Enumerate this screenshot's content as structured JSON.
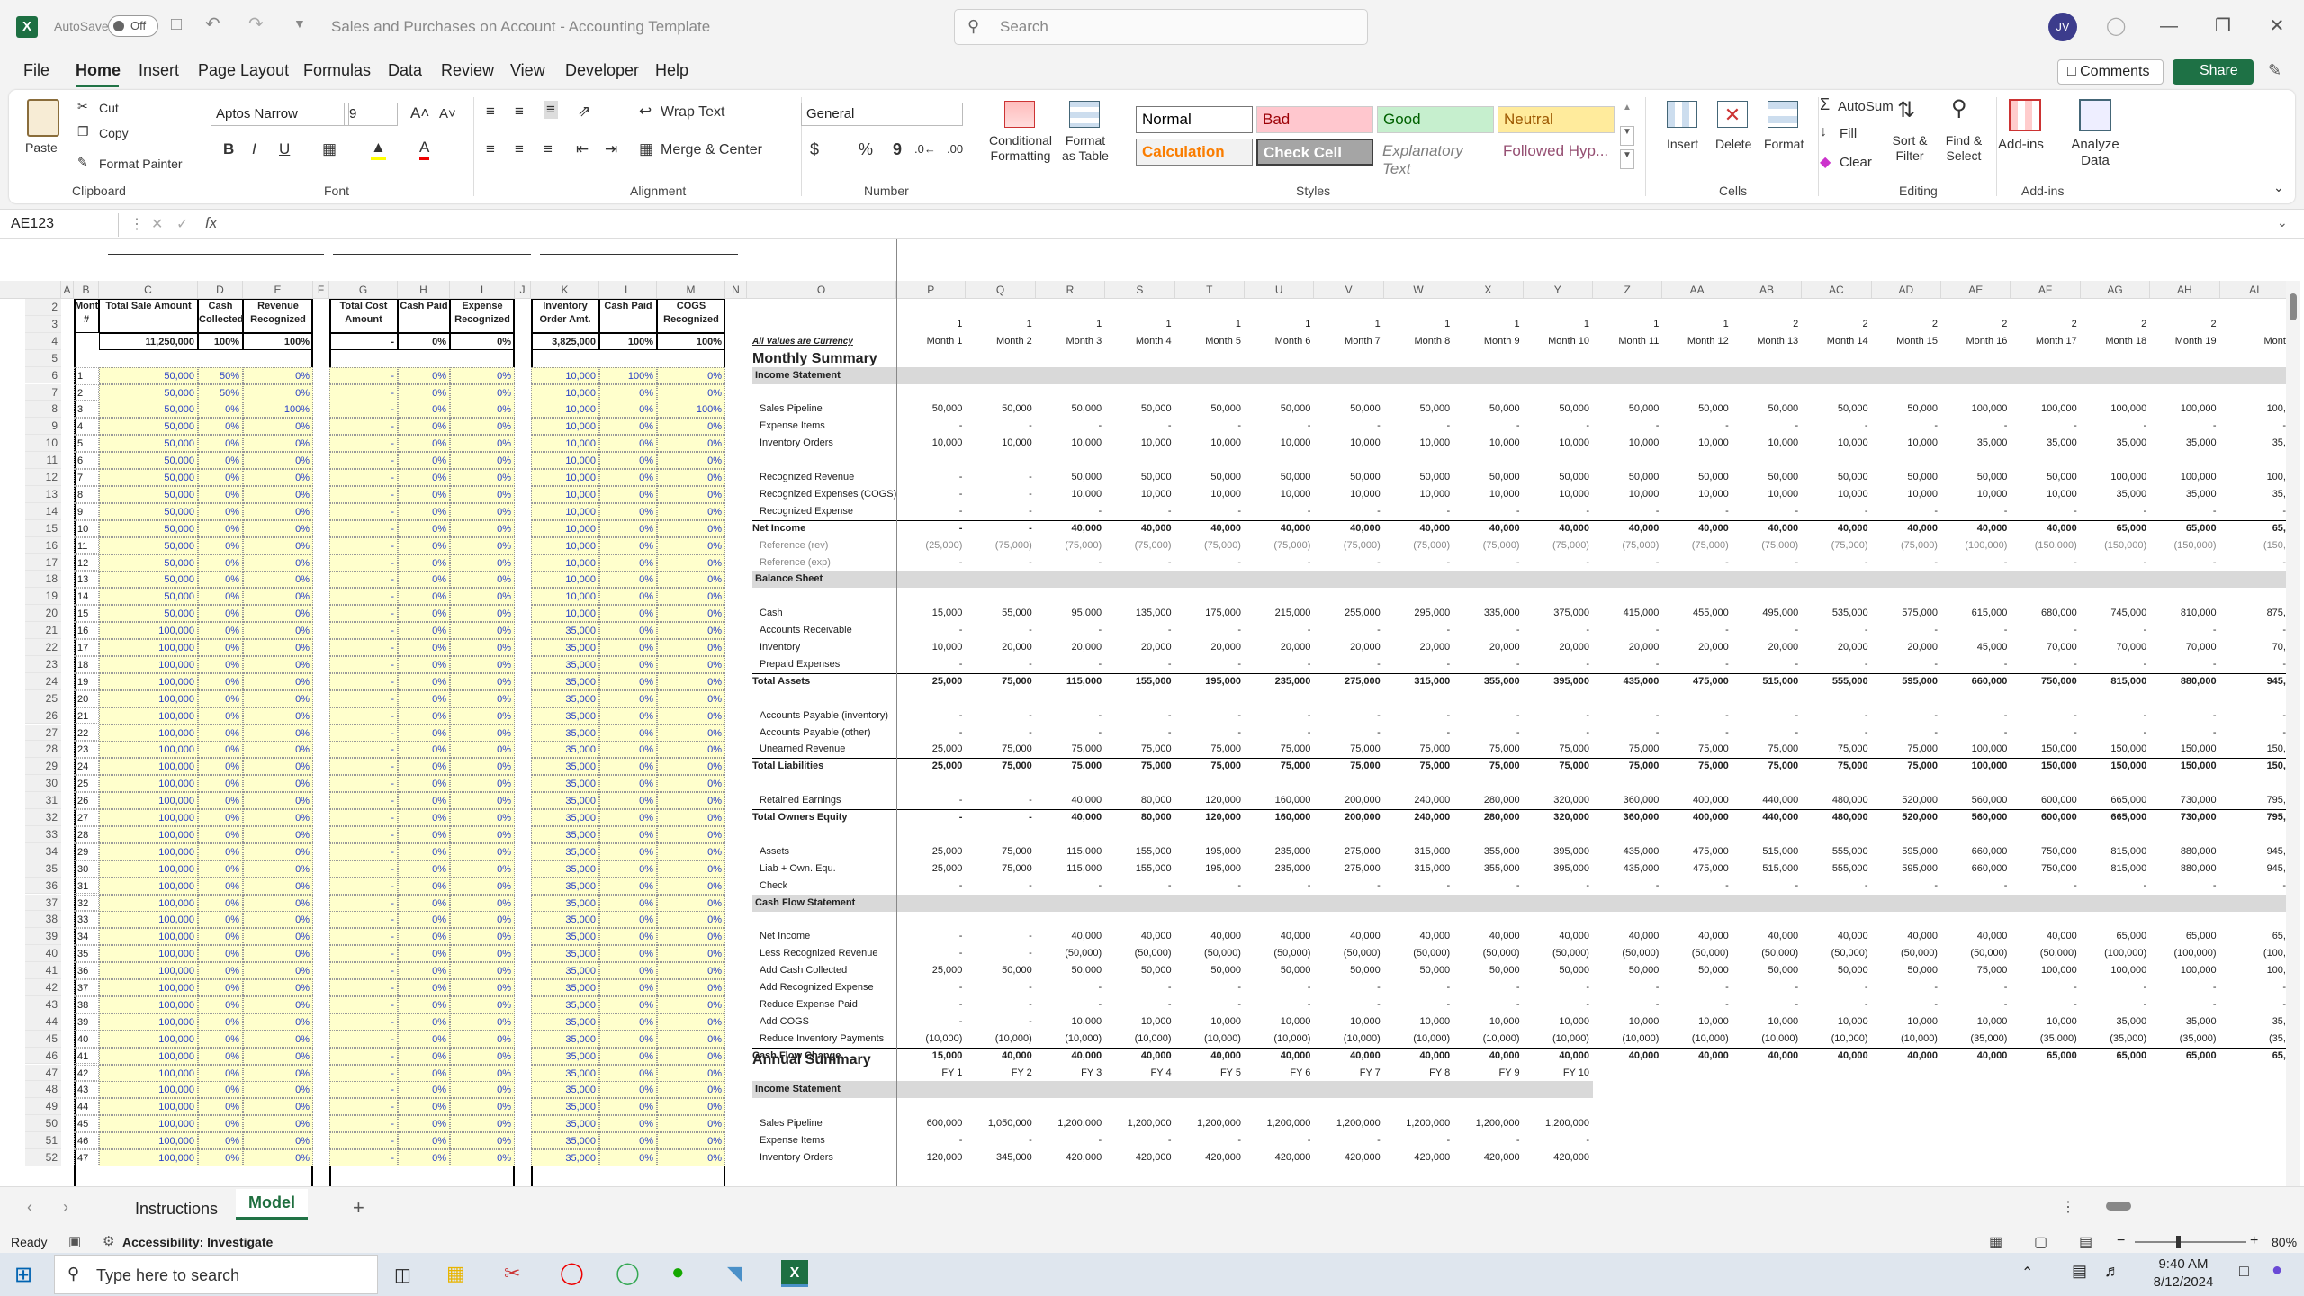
{
  "app": {
    "autosave": "AutoSave",
    "autosave_state": "Off",
    "title": "Sales and Purchases on Account - Accounting Template",
    "search_placeholder": "Search",
    "user_initials": "JV"
  },
  "menu": [
    "File",
    "Home",
    "Insert",
    "Page Layout",
    "Formulas",
    "Data",
    "Review",
    "View",
    "Developer",
    "Help"
  ],
  "menu_right": {
    "comments": "Comments",
    "share": "Share"
  },
  "ribbon": {
    "clipboard": {
      "paste": "Paste",
      "cut": "Cut",
      "copy": "Copy",
      "format_painter": "Format Painter",
      "label": "Clipboard"
    },
    "font": {
      "name": "Aptos Narrow",
      "size": "9",
      "label": "Font"
    },
    "alignment": {
      "wrap": "Wrap Text",
      "merge": "Merge & Center",
      "label": "Alignment"
    },
    "number": {
      "format": "General",
      "label": "Number"
    },
    "styles": {
      "cond": "Conditional Formatting",
      "table": "Format as Table",
      "normal": "Normal",
      "bad": "Bad",
      "good": "Good",
      "neutral": "Neutral",
      "calc": "Calculation",
      "check": "Check Cell",
      "explan": "Explanatory Text",
      "followed": "Followed Hyp...",
      "label": "Styles"
    },
    "cells": {
      "insert": "Insert",
      "delete": "Delete",
      "format": "Format",
      "label": "Cells"
    },
    "editing": {
      "autosum": "AutoSum",
      "fill": "Fill",
      "clear": "Clear",
      "sort": "Sort & Filter",
      "find": "Find & Select",
      "label": "Editing"
    },
    "addins": {
      "addins": "Add-ins",
      "analyze": "Analyze Data",
      "label": "Add-ins"
    }
  },
  "namebox": "AE123",
  "fx": "fx",
  "col_headers": [
    "A",
    "B",
    "C",
    "D",
    "E",
    "F",
    "G",
    "H",
    "I",
    "J",
    "K",
    "L",
    "M",
    "N",
    "O",
    "P",
    "Q",
    "R",
    "S",
    "T",
    "U",
    "V",
    "W",
    "X",
    "Y",
    "Z",
    "AA",
    "AB",
    "AC",
    "AD",
    "AE",
    "AF",
    "AG",
    "AH",
    "AI"
  ],
  "left_headers": {
    "month": "Month #",
    "total_sale": "Total Sale Amount",
    "cash_collected": "Cash Collected",
    "rev_recog": "Revenue Recognized",
    "total_cost": "Total Cost Amount",
    "cash_paid": "Cash Paid",
    "exp_recog": "Expense Recognized",
    "inv_order": "Inventory Order Amt.",
    "cash_paid2": "Cash Paid",
    "cogs_recog": "COGS Recognized"
  },
  "left_totals": {
    "sale": "11,250,000",
    "cc": "100%",
    "rr": "100%",
    "cost": "-",
    "cp": "0%",
    "er": "0%",
    "inv": "3,825,000",
    "cp2": "100%",
    "cogs": "100%"
  },
  "currency_note": "All Values are Currency",
  "month_labels": [
    "Month 1",
    "Month 2",
    "Month 3",
    "Month 4",
    "Month 5",
    "Month 6",
    "Month 7",
    "Month 8",
    "Month 9",
    "Month 10",
    "Month 11",
    "Month 12",
    "Month 13",
    "Month 14",
    "Month 15",
    "Month 16",
    "Month 17",
    "Month 18",
    "Month 19",
    "Mont"
  ],
  "year_labels": [
    "1",
    "1",
    "1",
    "1",
    "1",
    "1",
    "1",
    "1",
    "1",
    "1",
    "1",
    "1",
    "2",
    "2",
    "2",
    "2",
    "2",
    "2",
    "2",
    ""
  ],
  "summary": {
    "monthly": "Monthly Summary",
    "income": "Income Statement",
    "balance": "Balance Sheet",
    "cashflow": "Cash Flow Statement",
    "annual": "Annual Summary",
    "fy": [
      "FY 1",
      "FY 2",
      "FY 3",
      "FY 4",
      "FY 5",
      "FY 6",
      "FY 7",
      "FY 8",
      "FY 9",
      "FY 10"
    ]
  },
  "rows": [
    {
      "r": 6,
      "label": "Sales Pipeline",
      "v": [
        "50,000",
        "50,000",
        "50,000",
        "50,000",
        "50,000",
        "50,000",
        "50,000",
        "50,000",
        "50,000",
        "50,000",
        "50,000",
        "50,000",
        "50,000",
        "50,000",
        "50,000",
        "100,000",
        "100,000",
        "100,000",
        "100,000",
        "100,"
      ]
    },
    {
      "r": 7,
      "label": "Expense Items",
      "v": [
        "-",
        "-",
        "-",
        "-",
        "-",
        "-",
        "-",
        "-",
        "-",
        "-",
        "-",
        "-",
        "-",
        "-",
        "-",
        "-",
        "-",
        "-",
        "-",
        "-"
      ]
    },
    {
      "r": 8,
      "label": "Inventory Orders",
      "v": [
        "10,000",
        "10,000",
        "10,000",
        "10,000",
        "10,000",
        "10,000",
        "10,000",
        "10,000",
        "10,000",
        "10,000",
        "10,000",
        "10,000",
        "10,000",
        "10,000",
        "10,000",
        "35,000",
        "35,000",
        "35,000",
        "35,000",
        "35,"
      ]
    },
    {
      "r": 10,
      "label": "Recognized Revenue",
      "v": [
        "-",
        "-",
        "50,000",
        "50,000",
        "50,000",
        "50,000",
        "50,000",
        "50,000",
        "50,000",
        "50,000",
        "50,000",
        "50,000",
        "50,000",
        "50,000",
        "50,000",
        "50,000",
        "50,000",
        "100,000",
        "100,000",
        "100,"
      ]
    },
    {
      "r": 11,
      "label": "Recognized Expenses (COGS)",
      "v": [
        "-",
        "-",
        "10,000",
        "10,000",
        "10,000",
        "10,000",
        "10,000",
        "10,000",
        "10,000",
        "10,000",
        "10,000",
        "10,000",
        "10,000",
        "10,000",
        "10,000",
        "10,000",
        "10,000",
        "35,000",
        "35,000",
        "35,"
      ]
    },
    {
      "r": 12,
      "label": "Recognized Expense",
      "v": [
        "-",
        "-",
        "-",
        "-",
        "-",
        "-",
        "-",
        "-",
        "-",
        "-",
        "-",
        "-",
        "-",
        "-",
        "-",
        "-",
        "-",
        "-",
        "-",
        "-"
      ]
    },
    {
      "r": 13,
      "label": "Net Income",
      "bold": true,
      "v": [
        "-",
        "-",
        "40,000",
        "40,000",
        "40,000",
        "40,000",
        "40,000",
        "40,000",
        "40,000",
        "40,000",
        "40,000",
        "40,000",
        "40,000",
        "40,000",
        "40,000",
        "40,000",
        "40,000",
        "65,000",
        "65,000",
        "65,"
      ]
    },
    {
      "r": 14,
      "label": "Reference (rev)",
      "grey": true,
      "v": [
        "(25,000)",
        "(75,000)",
        "(75,000)",
        "(75,000)",
        "(75,000)",
        "(75,000)",
        "(75,000)",
        "(75,000)",
        "(75,000)",
        "(75,000)",
        "(75,000)",
        "(75,000)",
        "(75,000)",
        "(75,000)",
        "(75,000)",
        "(100,000)",
        "(150,000)",
        "(150,000)",
        "(150,000)",
        "(150,"
      ]
    },
    {
      "r": 15,
      "label": "Reference (exp)",
      "grey": true,
      "v": [
        "-",
        "-",
        "-",
        "-",
        "-",
        "-",
        "-",
        "-",
        "-",
        "-",
        "-",
        "-",
        "-",
        "-",
        "-",
        "-",
        "-",
        "-",
        "-",
        "-"
      ]
    },
    {
      "r": 18,
      "label": "Cash",
      "v": [
        "15,000",
        "55,000",
        "95,000",
        "135,000",
        "175,000",
        "215,000",
        "255,000",
        "295,000",
        "335,000",
        "375,000",
        "415,000",
        "455,000",
        "495,000",
        "535,000",
        "575,000",
        "615,000",
        "680,000",
        "745,000",
        "810,000",
        "875,"
      ]
    },
    {
      "r": 19,
      "label": "Accounts Receivable",
      "v": [
        "-",
        "-",
        "-",
        "-",
        "-",
        "-",
        "-",
        "-",
        "-",
        "-",
        "-",
        "-",
        "-",
        "-",
        "-",
        "-",
        "-",
        "-",
        "-",
        "-"
      ]
    },
    {
      "r": 20,
      "label": "Inventory",
      "v": [
        "10,000",
        "20,000",
        "20,000",
        "20,000",
        "20,000",
        "20,000",
        "20,000",
        "20,000",
        "20,000",
        "20,000",
        "20,000",
        "20,000",
        "20,000",
        "20,000",
        "20,000",
        "45,000",
        "70,000",
        "70,000",
        "70,000",
        "70,"
      ]
    },
    {
      "r": 21,
      "label": "Prepaid Expenses",
      "v": [
        "-",
        "-",
        "-",
        "-",
        "-",
        "-",
        "-",
        "-",
        "-",
        "-",
        "-",
        "-",
        "-",
        "-",
        "-",
        "-",
        "-",
        "-",
        "-",
        "-"
      ]
    },
    {
      "r": 22,
      "label": "Total Assets",
      "bold": true,
      "v": [
        "25,000",
        "75,000",
        "115,000",
        "155,000",
        "195,000",
        "235,000",
        "275,000",
        "315,000",
        "355,000",
        "395,000",
        "435,000",
        "475,000",
        "515,000",
        "555,000",
        "595,000",
        "660,000",
        "750,000",
        "815,000",
        "880,000",
        "945,"
      ]
    },
    {
      "r": 24,
      "label": "Accounts Payable (inventory)",
      "v": [
        "-",
        "-",
        "-",
        "-",
        "-",
        "-",
        "-",
        "-",
        "-",
        "-",
        "-",
        "-",
        "-",
        "-",
        "-",
        "-",
        "-",
        "-",
        "-",
        "-"
      ]
    },
    {
      "r": 25,
      "label": "Accounts Payable (other)",
      "v": [
        "-",
        "-",
        "-",
        "-",
        "-",
        "-",
        "-",
        "-",
        "-",
        "-",
        "-",
        "-",
        "-",
        "-",
        "-",
        "-",
        "-",
        "-",
        "-",
        "-"
      ]
    },
    {
      "r": 26,
      "label": "Unearned Revenue",
      "v": [
        "25,000",
        "75,000",
        "75,000",
        "75,000",
        "75,000",
        "75,000",
        "75,000",
        "75,000",
        "75,000",
        "75,000",
        "75,000",
        "75,000",
        "75,000",
        "75,000",
        "75,000",
        "100,000",
        "150,000",
        "150,000",
        "150,000",
        "150,"
      ]
    },
    {
      "r": 27,
      "label": "Total Liabilities",
      "bold": true,
      "v": [
        "25,000",
        "75,000",
        "75,000",
        "75,000",
        "75,000",
        "75,000",
        "75,000",
        "75,000",
        "75,000",
        "75,000",
        "75,000",
        "75,000",
        "75,000",
        "75,000",
        "75,000",
        "100,000",
        "150,000",
        "150,000",
        "150,000",
        "150,"
      ]
    },
    {
      "r": 29,
      "label": "Retained Earnings",
      "v": [
        "-",
        "-",
        "40,000",
        "80,000",
        "120,000",
        "160,000",
        "200,000",
        "240,000",
        "280,000",
        "320,000",
        "360,000",
        "400,000",
        "440,000",
        "480,000",
        "520,000",
        "560,000",
        "600,000",
        "665,000",
        "730,000",
        "795,"
      ]
    },
    {
      "r": 30,
      "label": "Total Owners Equity",
      "bold": true,
      "v": [
        "-",
        "-",
        "40,000",
        "80,000",
        "120,000",
        "160,000",
        "200,000",
        "240,000",
        "280,000",
        "320,000",
        "360,000",
        "400,000",
        "440,000",
        "480,000",
        "520,000",
        "560,000",
        "600,000",
        "665,000",
        "730,000",
        "795,"
      ]
    },
    {
      "r": 32,
      "label": "Assets",
      "v": [
        "25,000",
        "75,000",
        "115,000",
        "155,000",
        "195,000",
        "235,000",
        "275,000",
        "315,000",
        "355,000",
        "395,000",
        "435,000",
        "475,000",
        "515,000",
        "555,000",
        "595,000",
        "660,000",
        "750,000",
        "815,000",
        "880,000",
        "945,"
      ]
    },
    {
      "r": 33,
      "label": "Liab + Own. Equ.",
      "v": [
        "25,000",
        "75,000",
        "115,000",
        "155,000",
        "195,000",
        "235,000",
        "275,000",
        "315,000",
        "355,000",
        "395,000",
        "435,000",
        "475,000",
        "515,000",
        "555,000",
        "595,000",
        "660,000",
        "750,000",
        "815,000",
        "880,000",
        "945,"
      ]
    },
    {
      "r": 34,
      "label": "Check",
      "v": [
        "-",
        "-",
        "-",
        "-",
        "-",
        "-",
        "-",
        "-",
        "-",
        "-",
        "-",
        "-",
        "-",
        "-",
        "-",
        "-",
        "-",
        "-",
        "-",
        "-"
      ]
    },
    {
      "r": 37,
      "label": "Net Income",
      "v": [
        "-",
        "-",
        "40,000",
        "40,000",
        "40,000",
        "40,000",
        "40,000",
        "40,000",
        "40,000",
        "40,000",
        "40,000",
        "40,000",
        "40,000",
        "40,000",
        "40,000",
        "40,000",
        "40,000",
        "65,000",
        "65,000",
        "65,"
      ]
    },
    {
      "r": 38,
      "label": "Less Recognized Revenue",
      "v": [
        "-",
        "-",
        "(50,000)",
        "(50,000)",
        "(50,000)",
        "(50,000)",
        "(50,000)",
        "(50,000)",
        "(50,000)",
        "(50,000)",
        "(50,000)",
        "(50,000)",
        "(50,000)",
        "(50,000)",
        "(50,000)",
        "(50,000)",
        "(50,000)",
        "(100,000)",
        "(100,000)",
        "(100,"
      ]
    },
    {
      "r": 39,
      "label": "Add Cash Collected",
      "v": [
        "25,000",
        "50,000",
        "50,000",
        "50,000",
        "50,000",
        "50,000",
        "50,000",
        "50,000",
        "50,000",
        "50,000",
        "50,000",
        "50,000",
        "50,000",
        "50,000",
        "50,000",
        "75,000",
        "100,000",
        "100,000",
        "100,000",
        "100,"
      ]
    },
    {
      "r": 40,
      "label": "Add Recognized Expense",
      "v": [
        "-",
        "-",
        "-",
        "-",
        "-",
        "-",
        "-",
        "-",
        "-",
        "-",
        "-",
        "-",
        "-",
        "-",
        "-",
        "-",
        "-",
        "-",
        "-",
        "-"
      ]
    },
    {
      "r": 41,
      "label": "Reduce Expense Paid",
      "v": [
        "-",
        "-",
        "-",
        "-",
        "-",
        "-",
        "-",
        "-",
        "-",
        "-",
        "-",
        "-",
        "-",
        "-",
        "-",
        "-",
        "-",
        "-",
        "-",
        "-"
      ]
    },
    {
      "r": 42,
      "label": "Add COGS",
      "v": [
        "-",
        "-",
        "10,000",
        "10,000",
        "10,000",
        "10,000",
        "10,000",
        "10,000",
        "10,000",
        "10,000",
        "10,000",
        "10,000",
        "10,000",
        "10,000",
        "10,000",
        "10,000",
        "10,000",
        "35,000",
        "35,000",
        "35,"
      ]
    },
    {
      "r": 43,
      "label": "Reduce Inventory Payments",
      "v": [
        "(10,000)",
        "(10,000)",
        "(10,000)",
        "(10,000)",
        "(10,000)",
        "(10,000)",
        "(10,000)",
        "(10,000)",
        "(10,000)",
        "(10,000)",
        "(10,000)",
        "(10,000)",
        "(10,000)",
        "(10,000)",
        "(10,000)",
        "(35,000)",
        "(35,000)",
        "(35,000)",
        "(35,000)",
        "(35,"
      ]
    },
    {
      "r": 44,
      "label": "Cash Flow Change",
      "bold": true,
      "v": [
        "15,000",
        "40,000",
        "40,000",
        "40,000",
        "40,000",
        "40,000",
        "40,000",
        "40,000",
        "40,000",
        "40,000",
        "40,000",
        "40,000",
        "40,000",
        "40,000",
        "40,000",
        "40,000",
        "65,000",
        "65,000",
        "65,000",
        "65,"
      ]
    },
    {
      "r": 48,
      "label": "Sales Pipeline",
      "v": [
        "600,000",
        "1,050,000",
        "1,200,000",
        "1,200,000",
        "1,200,000",
        "1,200,000",
        "1,200,000",
        "1,200,000",
        "1,200,000",
        "1,200,000"
      ]
    },
    {
      "r": 49,
      "label": "Expense Items",
      "v": [
        "-",
        "-",
        "-",
        "-",
        "-",
        "-",
        "-",
        "-",
        "-",
        "-"
      ]
    },
    {
      "r": 50,
      "label": "Inventory Orders",
      "v": [
        "120,000",
        "345,000",
        "420,000",
        "420,000",
        "420,000",
        "420,000",
        "420,000",
        "420,000",
        "420,000",
        "420,000"
      ]
    }
  ],
  "tabs": {
    "t1": "Instructions",
    "t2": "Model"
  },
  "status": {
    "ready": "Ready",
    "access": "Accessibility: Investigate",
    "zoom": "80%"
  },
  "taskbar": {
    "search": "Type here to search",
    "time": "9:40 AM",
    "date": "8/12/2024"
  }
}
